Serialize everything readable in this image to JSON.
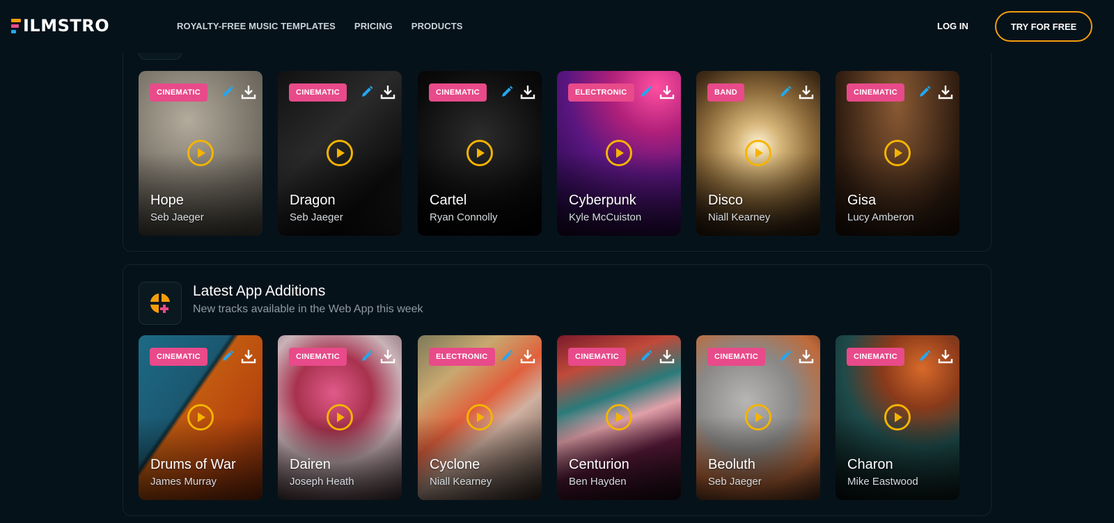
{
  "nav": {
    "logo_text": "ILMSTRO",
    "links": [
      "ROYALTY-FREE MUSIC TEMPLATES",
      "PRICING",
      "PRODUCTS"
    ],
    "login_label": "LOG IN",
    "cta_label": "TRY FOR FREE"
  },
  "colors": {
    "background": "#06121a",
    "accent": "#f59e0b",
    "tag": "#e84a8a",
    "edit_icon": "#22a8f0"
  },
  "section2": {
    "icon": "music-plus-icon",
    "title": "Latest App Additions",
    "subtitle": "New tracks available in the Web App this week"
  },
  "row1": [
    {
      "tag": "CINEMATIC",
      "title": "Hope",
      "author": "Seb Jaeger"
    },
    {
      "tag": "CINEMATIC",
      "title": "Dragon",
      "author": "Seb Jaeger"
    },
    {
      "tag": "CINEMATIC",
      "title": "Cartel",
      "author": "Ryan Connolly"
    },
    {
      "tag": "ELECTRONIC",
      "title": "Cyberpunk",
      "author": "Kyle McCuiston"
    },
    {
      "tag": "BAND",
      "title": "Disco",
      "author": "Niall Kearney"
    },
    {
      "tag": "CINEMATIC",
      "title": "Gisa",
      "author": "Lucy Amberon"
    }
  ],
  "row2": [
    {
      "tag": "CINEMATIC",
      "title": "Drums of War",
      "author": "James Murray"
    },
    {
      "tag": "CINEMATIC",
      "title": "Dairen",
      "author": "Joseph Heath"
    },
    {
      "tag": "ELECTRONIC",
      "title": "Cyclone",
      "author": "Niall Kearney"
    },
    {
      "tag": "CINEMATIC",
      "title": "Centurion",
      "author": "Ben Hayden"
    },
    {
      "tag": "CINEMATIC",
      "title": "Beoluth",
      "author": "Seb Jaeger"
    },
    {
      "tag": "CINEMATIC",
      "title": "Charon",
      "author": "Mike Eastwood"
    }
  ]
}
